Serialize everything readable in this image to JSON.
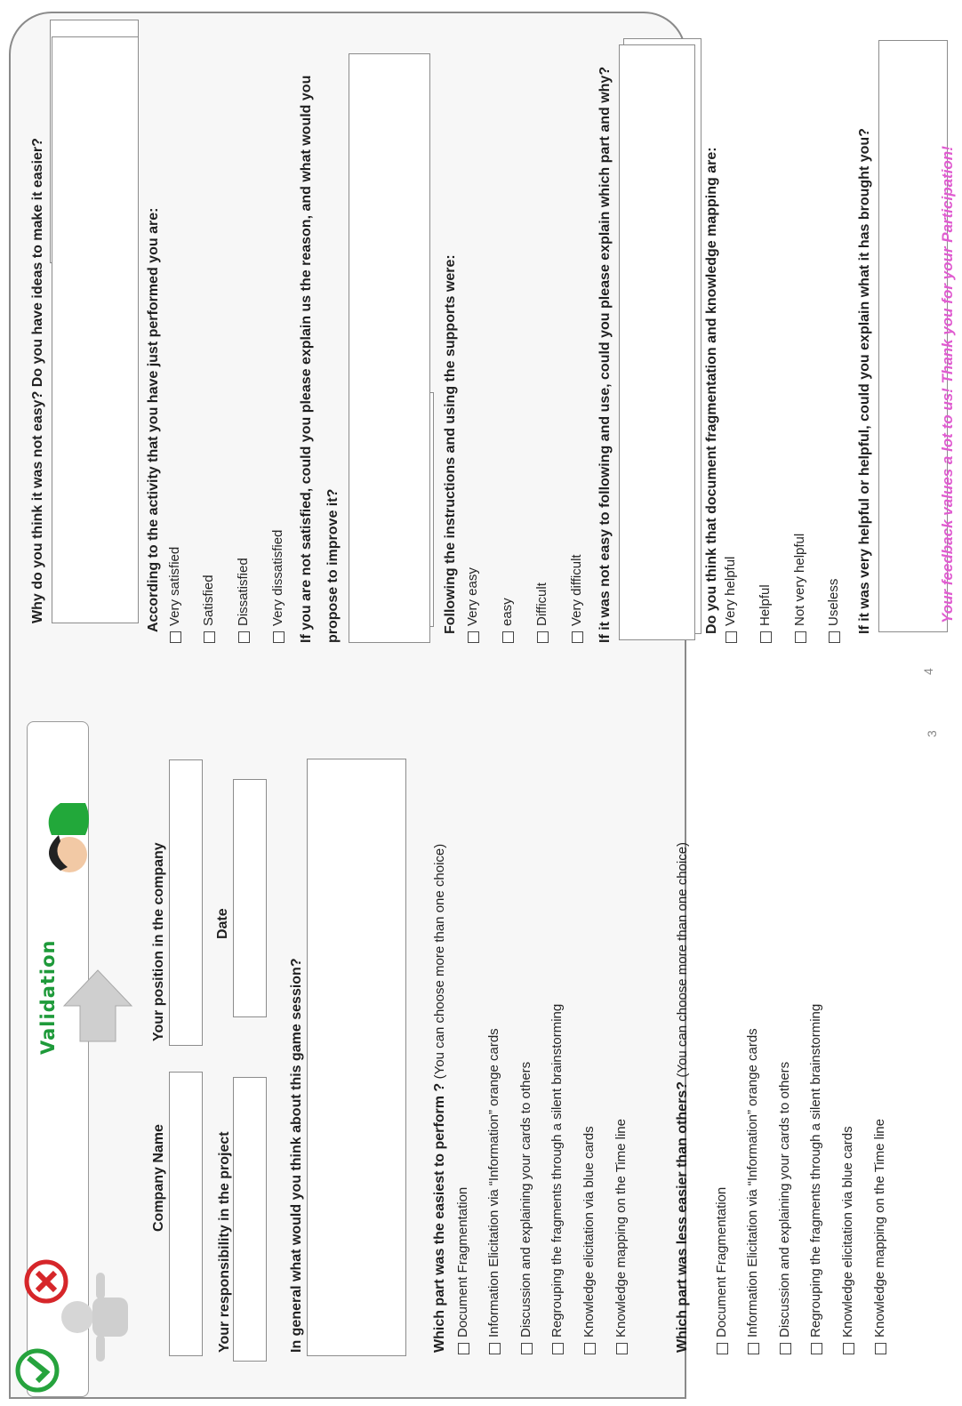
{
  "left_page": {
    "page_number": "3",
    "banner": {
      "title": "Validation"
    },
    "fields": {
      "company_name": "Company Name",
      "position": "Your position in the company",
      "responsibility": "Your responsibility in the project",
      "date": "Date",
      "general": "In general what would you think about this game session?"
    },
    "q_easiest": {
      "title": "Which part was the easiest to perform ?",
      "note": "(You can choose more than one choice)",
      "options": [
        "Document Fragmentation",
        "Information Elicitation via “Information” orange cards",
        "Discussion and explaining your cards to others",
        "Regrouping the fragments through a silent brainstorming",
        "Knowledge elicitation via blue cards",
        "Knowledge mapping on the Time line"
      ]
    },
    "q_less_easy": {
      "title": "Which part was less easier than others?",
      "note": "(You can choose more than one choice)",
      "options": [
        "Document Fragmentation",
        "Information Elicitation via “Information” orange cards",
        "Discussion and explaining your cards to others",
        "Regrouping the fragments through a silent brainstorming",
        "Knowledge elicitation via blue cards",
        "Knowledge mapping on the Time line"
      ]
    }
  },
  "right_page": {
    "page_number": "4",
    "q_why_not_easy": "Why do you think it was not easy? Do you have ideas to make it easier?",
    "q_satisfaction": {
      "title": "According to the activity that you have just performed you are:",
      "options": [
        "Very satisfied",
        "Satisfied",
        "Dissatisfied",
        "Very dissatisfied"
      ]
    },
    "q_not_satisfied_line1": "If you are not satisfied, could you please explain us the reason, and what would you",
    "q_not_satisfied_line2": "propose to improve it?",
    "q_instructions": {
      "title": "Following the instructions and using the supports were:",
      "options": [
        "Very easy",
        "easy",
        "Difficult",
        "Very difficult"
      ]
    },
    "q_not_easy_explain": "If it was not easy to following and use, could you please explain which part and why?",
    "q_helpful": {
      "title": "Do you think that document fragmentation and knowledge mapping are:",
      "options": [
        "Very helpful",
        "Helpful",
        "Not very helpful",
        "Useless"
      ]
    },
    "q_helpful_explain": "If it was very helpful or helpful, could you explain what it has brought you?",
    "thanks": "Your feedback values a lot to us! Thank you for your Participation!"
  },
  "colors": {
    "accent_green": "#1e9a3a",
    "thanks_pink": "#e05bd0"
  }
}
